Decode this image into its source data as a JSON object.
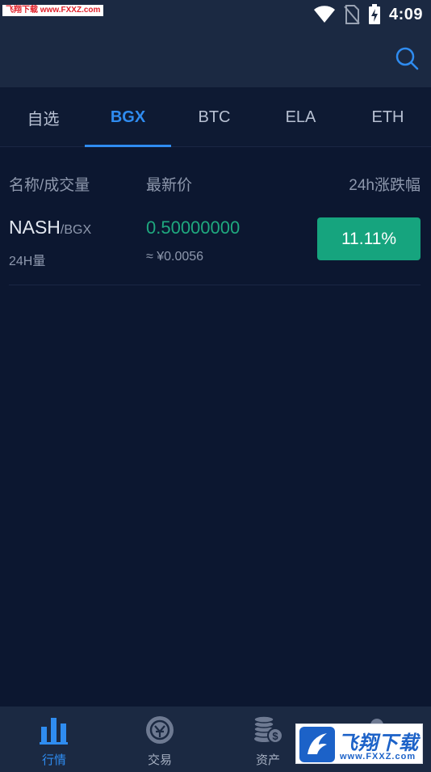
{
  "status_bar": {
    "watermark": "飞翔下载 www.FXXZ.com",
    "time": "4:09",
    "icons": [
      "wifi-icon",
      "no-sim-icon",
      "battery-charging-icon"
    ]
  },
  "header": {
    "search_icon": "search-icon"
  },
  "tabs": [
    {
      "label": "自选",
      "active": false
    },
    {
      "label": "BGX",
      "active": true
    },
    {
      "label": "BTC",
      "active": false
    },
    {
      "label": "ELA",
      "active": false
    },
    {
      "label": "ETH",
      "active": false
    }
  ],
  "columns": {
    "name_volume": "名称/成交量",
    "latest_price": "最新价",
    "change_24h": "24h涨跌幅"
  },
  "markets": [
    {
      "base": "NASH",
      "quote": "/BGX",
      "volume_label": "24H量",
      "price": "0.50000000",
      "price_cny": "≈ ¥0.0056",
      "change": "11.11%",
      "change_color": "#16a47e"
    }
  ],
  "bottom_nav": [
    {
      "label": "行情",
      "icon": "bar-chart-icon",
      "active": true
    },
    {
      "label": "交易",
      "icon": "exchange-icon",
      "active": false
    },
    {
      "label": "资产",
      "icon": "coins-icon",
      "active": false
    },
    {
      "label": "",
      "icon": "user-icon",
      "active": false
    }
  ],
  "watermark_bottom": {
    "title": "飞翔下载",
    "url": "www.FXXZ.com"
  },
  "colors": {
    "accent": "#2f8cf0",
    "up": "#16a47e",
    "background": "#0c1730",
    "header": "#1b2942"
  }
}
